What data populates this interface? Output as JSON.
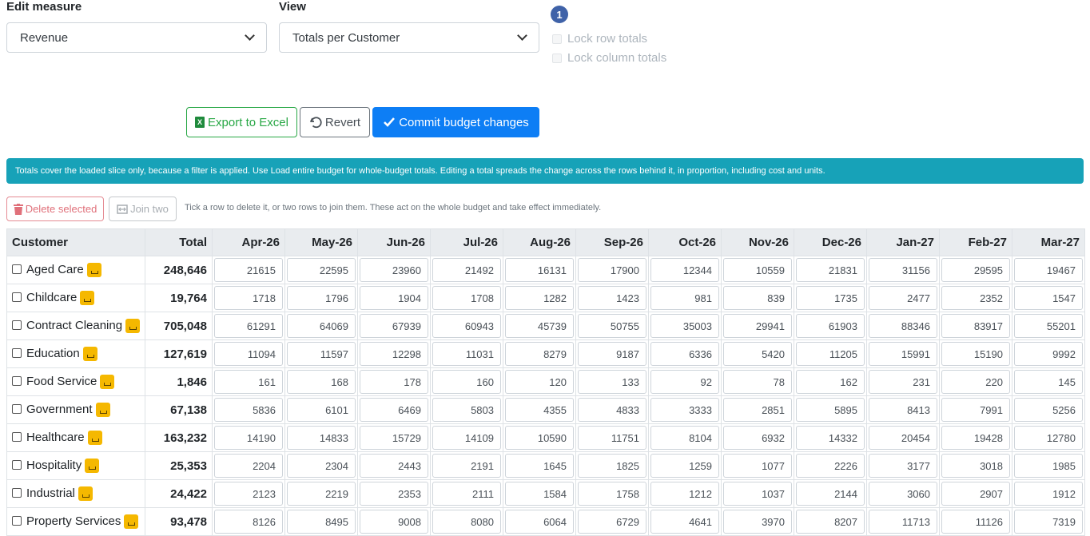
{
  "controls": {
    "edit_measure_label": "Edit measure",
    "edit_measure_value": "Revenue",
    "view_label": "View",
    "view_value": "Totals per Customer",
    "step_badge": "1",
    "lock_row_totals": "Lock row totals",
    "lock_column_totals": "Lock column totals"
  },
  "toolbar": {
    "excel_icon": "X",
    "export_label": "Export to Excel",
    "revert_label": "Revert",
    "commit_label": "Commit budget changes"
  },
  "alert": "Totals cover the loaded slice only, because a filter is applied. Use Load entire budget for whole-budget totals. Editing a total spreads the change across the rows behind it, in proportion, including cost and units.",
  "row_actions": {
    "delete_label": "Delete selected",
    "join_label": "Join two",
    "hint": "Tick a row to delete it, or two rows to join them. These act on the whole budget and take effect immediately."
  },
  "table": {
    "headers": [
      "Customer",
      "Total",
      "Apr-26",
      "May-26",
      "Jun-26",
      "Jul-26",
      "Aug-26",
      "Sep-26",
      "Oct-26",
      "Nov-26",
      "Dec-26",
      "Jan-27",
      "Feb-27",
      "Mar-27"
    ],
    "rows": [
      {
        "name": "Aged Care",
        "total": "248,646",
        "values": [
          "21615",
          "22595",
          "23960",
          "21492",
          "16131",
          "17900",
          "12344",
          "10559",
          "21831",
          "31156",
          "29595",
          "19467"
        ]
      },
      {
        "name": "Childcare",
        "total": "19,764",
        "values": [
          "1718",
          "1796",
          "1904",
          "1708",
          "1282",
          "1423",
          "981",
          "839",
          "1735",
          "2477",
          "2352",
          "1547"
        ]
      },
      {
        "name": "Contract Cleaning",
        "total": "705,048",
        "values": [
          "61291",
          "64069",
          "67939",
          "60943",
          "45739",
          "50755",
          "35003",
          "29941",
          "61903",
          "88346",
          "83917",
          "55201"
        ]
      },
      {
        "name": "Education",
        "total": "127,619",
        "values": [
          "11094",
          "11597",
          "12298",
          "11031",
          "8279",
          "9187",
          "6336",
          "5420",
          "11205",
          "15991",
          "15190",
          "9992"
        ]
      },
      {
        "name": "Food Service",
        "total": "1,846",
        "values": [
          "161",
          "168",
          "178",
          "160",
          "120",
          "133",
          "92",
          "78",
          "162",
          "231",
          "220",
          "145"
        ]
      },
      {
        "name": "Government",
        "total": "67,138",
        "values": [
          "5836",
          "6101",
          "6469",
          "5803",
          "4355",
          "4833",
          "3333",
          "2851",
          "5895",
          "8413",
          "7991",
          "5256"
        ]
      },
      {
        "name": "Healthcare",
        "total": "163,232",
        "values": [
          "14190",
          "14833",
          "15729",
          "14109",
          "10590",
          "11751",
          "8104",
          "6932",
          "14332",
          "20454",
          "19428",
          "12780"
        ]
      },
      {
        "name": "Hospitality",
        "total": "25,353",
        "values": [
          "2204",
          "2304",
          "2443",
          "2191",
          "1645",
          "1825",
          "1259",
          "1077",
          "2226",
          "3177",
          "3018",
          "1985"
        ]
      },
      {
        "name": "Industrial",
        "total": "24,422",
        "values": [
          "2123",
          "2219",
          "2353",
          "2111",
          "1584",
          "1758",
          "1212",
          "1037",
          "2144",
          "3060",
          "2907",
          "1912"
        ]
      },
      {
        "name": "Property Services",
        "total": "93,478",
        "values": [
          "8126",
          "8495",
          "9008",
          "8080",
          "6064",
          "6729",
          "4641",
          "3970",
          "8207",
          "11713",
          "11126",
          "7319"
        ]
      }
    ]
  },
  "colors": {
    "alert_bg": "#17a2b8",
    "commit_bg": "#0d7ef5",
    "export": "#28a745",
    "delete": "#e0707a",
    "tag": "#f5b800",
    "badge": "#3f62a8"
  }
}
